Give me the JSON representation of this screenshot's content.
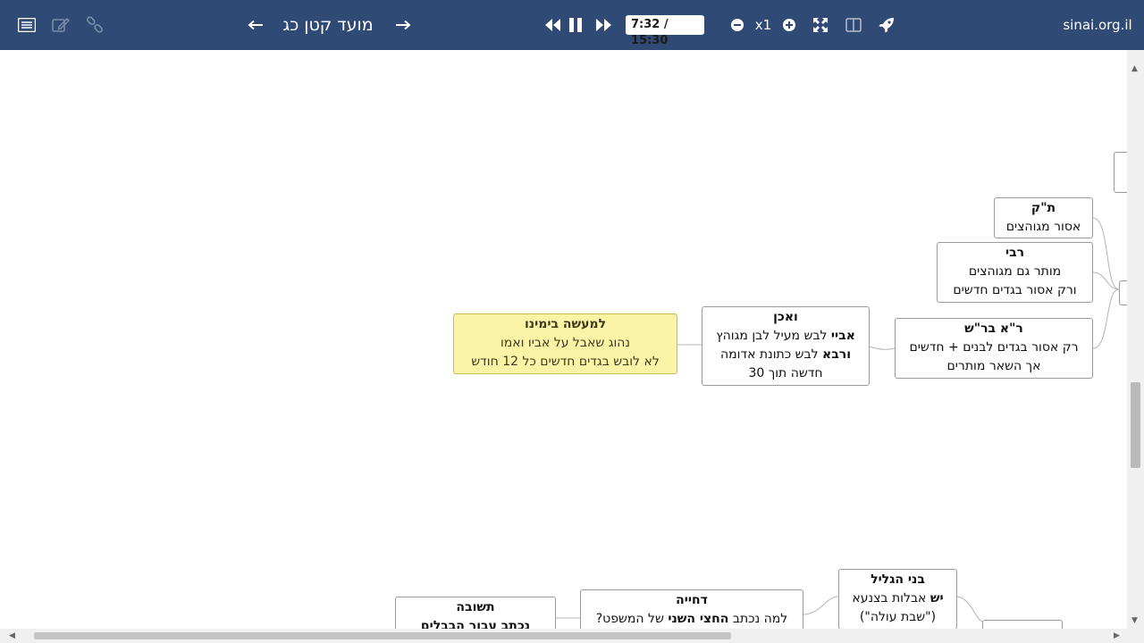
{
  "toolbar": {
    "title": "מועד קטן כג",
    "time": "7:32 / 15:30",
    "speed": "x1",
    "site": "sinai.org.il",
    "icons": [
      "list-icon",
      "edit-icon",
      "link-icon",
      "arrow-left-icon",
      "arrow-right-icon",
      "rewind-icon",
      "pause-icon",
      "fast-forward-icon",
      "zoom-out-icon",
      "zoom-in-icon",
      "fullscreen-icon",
      "split-view-icon",
      "rocket-icon"
    ]
  },
  "mindmap": {
    "nodes": [
      {
        "id": "tk",
        "head": "ת\"ק",
        "lines": [
          "אסור מגוהצים"
        ]
      },
      {
        "id": "rabi",
        "head": "רבי",
        "lines": [
          "מותר גם מגוהצים",
          "ורק אסור בגדים חדשים"
        ]
      },
      {
        "id": "rash",
        "head": "ר\"א בר\"ש",
        "lines": [
          "רק אסור בגדים לבנים + חדשים",
          "אך השאר מותרים"
        ]
      },
      {
        "id": "vaachen",
        "head": "ואכן",
        "rich": [
          [
            {
              "b": "אביי"
            },
            {
              "t": " לבש מעיל לבן מגוהץ"
            }
          ],
          [
            {
              "b": "ורבא"
            },
            {
              "t": " לבש כתונת אדומה"
            }
          ],
          [
            {
              "t": "חדשה תוך 30"
            }
          ]
        ]
      },
      {
        "id": "lemaase",
        "head": "למעשה בימינו",
        "lines": [
          "נהוג שאבל על אביו ואמו",
          "לא לובש בגדים חדשים כל 12 חודש"
        ]
      },
      {
        "id": "bnei",
        "head": "בני הגליל",
        "rich": [
          [
            {
              "b": "יש"
            },
            {
              "t": " אבלות בצנעא"
            }
          ],
          [
            {
              "t": "(\"שבת עולה\")"
            }
          ]
        ]
      },
      {
        "id": "dchiya",
        "head": "דחייה",
        "rich": [
          [
            {
              "t": "למה נכתב "
            },
            {
              "b": "החצי השני"
            },
            {
              "t": " של המשפט?"
            }
          ]
        ]
      },
      {
        "id": "tshuva",
        "head": "תשובה",
        "lines": [
          "נכתב עבור הבבלים"
        ]
      }
    ]
  },
  "colors": {
    "toolbar": "#2f4a74",
    "highlight": "#fbf3a6",
    "border": "#9a9a9a"
  }
}
